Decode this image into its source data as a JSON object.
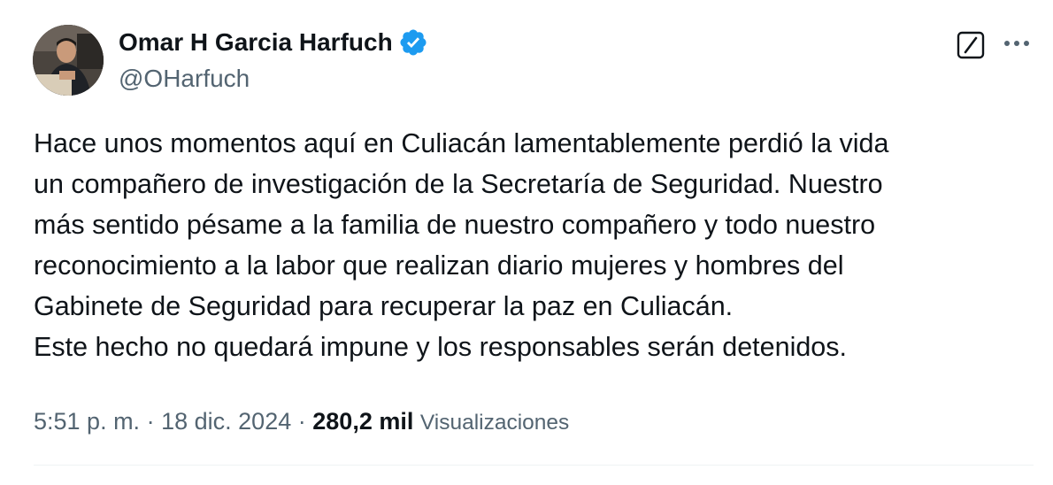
{
  "author": {
    "name": "Omar H Garcia Harfuch",
    "handle": "@OHarfuch",
    "verified": true,
    "avatar_icon": "profile-photo",
    "verified_color": "#1d9bf0"
  },
  "actions": {
    "grok_icon": "grok-icon",
    "more_icon": "more-horizontal-icon"
  },
  "tweet": {
    "lines": [
      "Hace unos momentos aquí en Culiacán lamentablemente perdió la vida",
      "un compañero de investigación de la Secretaría de Seguridad. Nuestro",
      "más sentido pésame a la familia de nuestro compañero y todo nuestro",
      "reconocimiento a la labor que realizan diario mujeres y hombres del",
      "Gabinete de Seguridad para recuperar la paz en Culiacán.",
      "Este hecho no quedará impune y los responsables serán detenidos."
    ]
  },
  "meta": {
    "time": "5:51 p. m.",
    "separator": "·",
    "date": "18 dic. 2024",
    "views_count": "280,2 mil",
    "views_label": "Visualizaciones"
  },
  "colors": {
    "text": "#0f1419",
    "secondary": "#536471",
    "divider": "#eff3f4",
    "verified": "#1d9bf0"
  }
}
